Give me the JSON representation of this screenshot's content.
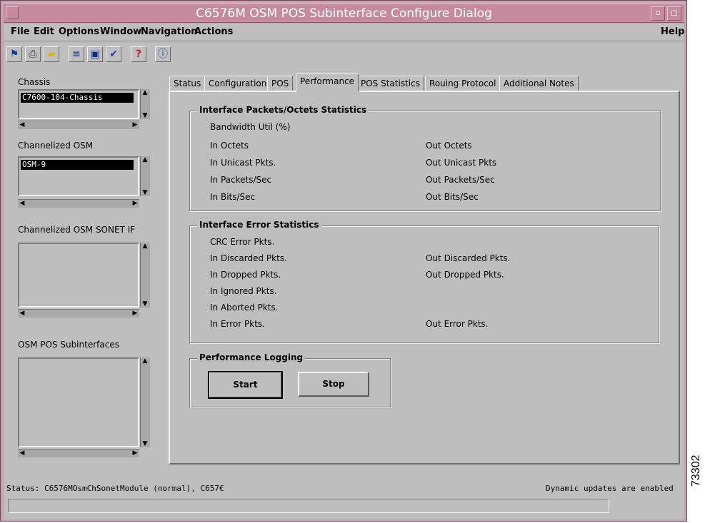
{
  "window": {
    "title": "C6576M OSM POS Subinterface Configure Dialog",
    "minimize_glyph": "▫",
    "maximize_glyph": "□"
  },
  "menu": {
    "file": "File",
    "edit": "Edit",
    "options": "Options",
    "window": "Window",
    "navigation": "Navigation",
    "actions": "Actions",
    "help": "Help"
  },
  "toolbar": {
    "icons": [
      "navigate-icon",
      "print-icon",
      "open-folder-icon",
      "list-icon",
      "monitor-icon",
      "checkmark-icon",
      "help-icon",
      "info-icon"
    ],
    "glyphs": [
      "⚑",
      "⎙",
      "▰",
      "≡",
      "▣",
      "✔",
      "?",
      "ⓘ"
    ]
  },
  "left": {
    "chassis_label": "Chassis",
    "chassis_selected": "C7600-104-Chassis",
    "osm_label": "Channelized OSM",
    "osm_selected": "OSM-9",
    "sonet_label": "Channelized OSM SONET IF",
    "subif_label": "OSM POS Subinterfaces"
  },
  "tabs": [
    "Status",
    "Configuration",
    "POS",
    "Performance",
    "POS Statistics",
    "Rouing Protocol",
    "Additional Notes"
  ],
  "active_tab": "Performance",
  "packets_group": {
    "title": "Interface Packets/Octets Statistics",
    "bandwidth": "Bandwidth Util (%)",
    "in_octets": "In Octets",
    "out_octets": "Out Octets",
    "in_unicast": "In Unicast Pkts.",
    "out_unicast": "Out Unicast Pkts",
    "in_pps": "In Packets/Sec",
    "out_pps": "Out Packets/Sec",
    "in_bps": "In Bits/Sec",
    "out_bps": "Out Bits/Sec"
  },
  "error_group": {
    "title": "Interface Error Statistics",
    "crc": "CRC Error Pkts.",
    "in_discarded": "In Discarded Pkts.",
    "out_discarded": "Out Discarded Pkts.",
    "in_dropped": "In Dropped Pkts.",
    "out_dropped": "Out Dropped Pkts.",
    "in_ignored": "In Ignored Pkts.",
    "in_aborted": "In Aborted Pkts.",
    "in_error": "In Error Pkts.",
    "out_error": "Out Error Pkts."
  },
  "logging_group": {
    "title": "Performance Logging",
    "start": "Start",
    "stop": "Stop"
  },
  "statusbar": {
    "status": "Status: C6576MOsmChSonetModule (normal), C657€",
    "updates": "Dynamic updates are enabled"
  },
  "figure_number": "73302"
}
